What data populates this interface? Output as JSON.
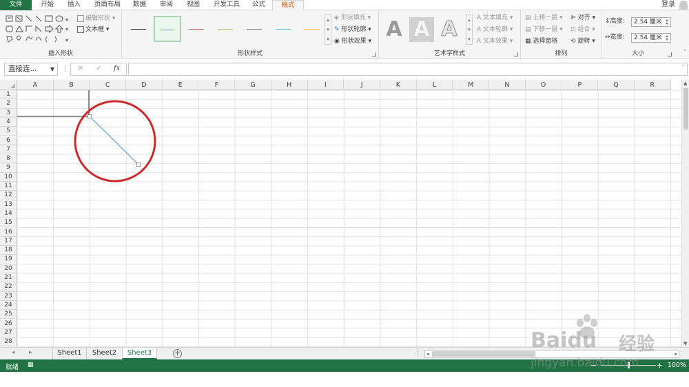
{
  "tabs": [
    {
      "label": "文件",
      "key": "file"
    },
    {
      "label": "开始",
      "key": "home"
    },
    {
      "label": "插入",
      "key": "insert"
    },
    {
      "label": "页面布局",
      "key": "layout"
    },
    {
      "label": "数据",
      "key": "data"
    },
    {
      "label": "审阅",
      "key": "review"
    },
    {
      "label": "视图",
      "key": "view"
    },
    {
      "label": "开发工具",
      "key": "developer"
    },
    {
      "label": "公式",
      "key": "formulas"
    },
    {
      "label": "格式",
      "key": "format",
      "active": true
    }
  ],
  "login_label": "登录",
  "ribbon": {
    "insert_shapes": {
      "label": "插入形状",
      "edit_shape": "编辑形状",
      "text_box": "文本框"
    },
    "shape_styles": {
      "label": "形状样式",
      "fill": "形状填充",
      "outline": "形状轮廓",
      "effects": "形状效果",
      "line_colors": [
        "#333333",
        "#5b9bd5",
        "#c86060",
        "#a9c46c",
        "#7f7f7f",
        "#66bfd9",
        "#f2c45b"
      ]
    },
    "wordart": {
      "label": "艺术字样式",
      "text_fill": "文本填充",
      "text_outline": "文本轮廓",
      "text_effects": "文本效果",
      "letter": "A"
    },
    "arrange": {
      "label": "排列",
      "bring_forward": "上移一层",
      "send_backward": "下移一层",
      "selection_pane": "选择窗格",
      "align": "对齐",
      "group": "组合",
      "rotate": "旋转"
    },
    "size": {
      "label": "大小",
      "height_label": "高度:",
      "height_value": "2.54 厘米",
      "width_label": "宽度:",
      "width_value": "2.54 厘米"
    }
  },
  "formula_bar": {
    "name_box": "直接连...",
    "cancel_symbol": "✕",
    "enter_symbol": "✓",
    "fx_symbol": "fx",
    "value": ""
  },
  "columns": [
    "A",
    "B",
    "C",
    "D",
    "E",
    "F",
    "G",
    "H",
    "I",
    "J",
    "K",
    "L",
    "M",
    "N",
    "O",
    "P",
    "Q",
    "R"
  ],
  "rows": [
    "1",
    "2",
    "3",
    "4",
    "5",
    "6",
    "7",
    "8",
    "9",
    "10",
    "11",
    "12",
    "13",
    "14",
    "15",
    "16",
    "17",
    "18",
    "19",
    "20",
    "21",
    "22",
    "23",
    "24",
    "25",
    "26",
    "27",
    "28"
  ],
  "sheets": [
    {
      "label": "Sheet1"
    },
    {
      "label": "Sheet2"
    },
    {
      "label": "Sheet3",
      "active": true
    }
  ],
  "status": {
    "ready": "就绪",
    "zoom": "100%"
  },
  "colors": {
    "accent": "#217346",
    "active_tab_text": "#c55a11",
    "highlight_circle": "#cc2a2a",
    "line_shape": "#5b9bd5"
  },
  "watermark": {
    "brand": "Baidu",
    "brand_cn": "经验",
    "url": "jingyan.baidu.com"
  }
}
